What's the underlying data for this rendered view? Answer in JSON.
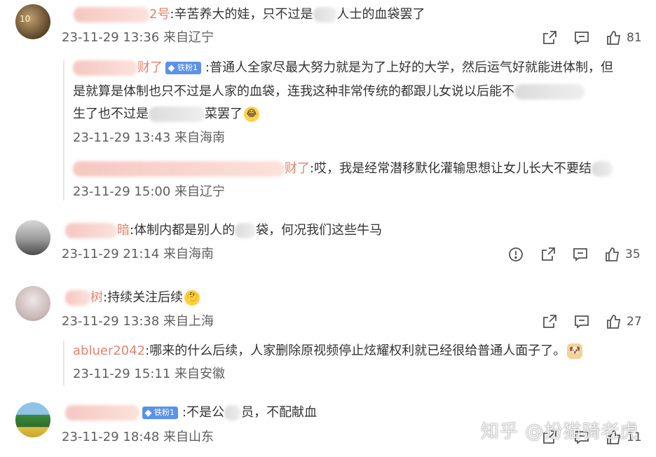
{
  "comments": [
    {
      "username_suffix": "2号",
      "text_before_blur": ":辛苦养大的娃，只不过是",
      "text_after_blur": "人士的血袋罢了",
      "time": "23-11-29 13:36",
      "location": "来自辽宁",
      "likes": "81",
      "replies": [
        {
          "username_suffix": "财了",
          "badge": "铁粉1",
          "line1": ":普通人全家尽最大努力就是为了上好的大学，然后运气好就能进体制，但",
          "line2": "是就算是体制也只不过是人家的血袋，连我这种非常传统的都跟儿女说以后能不",
          "line3_before_blur": "生了也不过是",
          "line3_after_blur": "菜罢了",
          "emoji": "laughing-emoji",
          "time": "23-11-29 13:43",
          "location": "来自海南"
        },
        {
          "username_suffix": "财了",
          "text": ":哎，我是经常潜移默化灌输思想让女儿长大不要结",
          "time": "23-11-29 15:00",
          "location": "来自辽宁"
        }
      ]
    },
    {
      "username_suffix": "暗",
      "text_before_blur": ":体制内都是别人的",
      "text_after_blur": "袋，何况我们这些牛马",
      "time": "23-11-29 21:14",
      "location": "来自海南",
      "likes": "35"
    },
    {
      "username_suffix": "树",
      "text": ":持续关注后续",
      "emoji": "thinking-emoji",
      "time": "23-11-29 13:38",
      "location": "来自上海",
      "likes": "27",
      "replies": [
        {
          "username": "abluer2042",
          "text": ":哪来的什么后续，人家删除原视频停止炫耀权利就已经很给普通人面子了。",
          "emoji": "doge-emoji",
          "time": "23-11-29 15:11",
          "location": "来自安徽"
        }
      ]
    },
    {
      "badge": "铁粉1",
      "text_before_blur": ":不是公",
      "text_after_blur": "员，不配献血",
      "time": "23-11-29 18:48",
      "location": "来自山东",
      "likes": "11"
    }
  ],
  "watermark": "知乎 @扮猫骑老虎",
  "colors": {
    "username": "#e8826e",
    "meta": "#5f5f5f",
    "badge": "#5a93e8"
  }
}
